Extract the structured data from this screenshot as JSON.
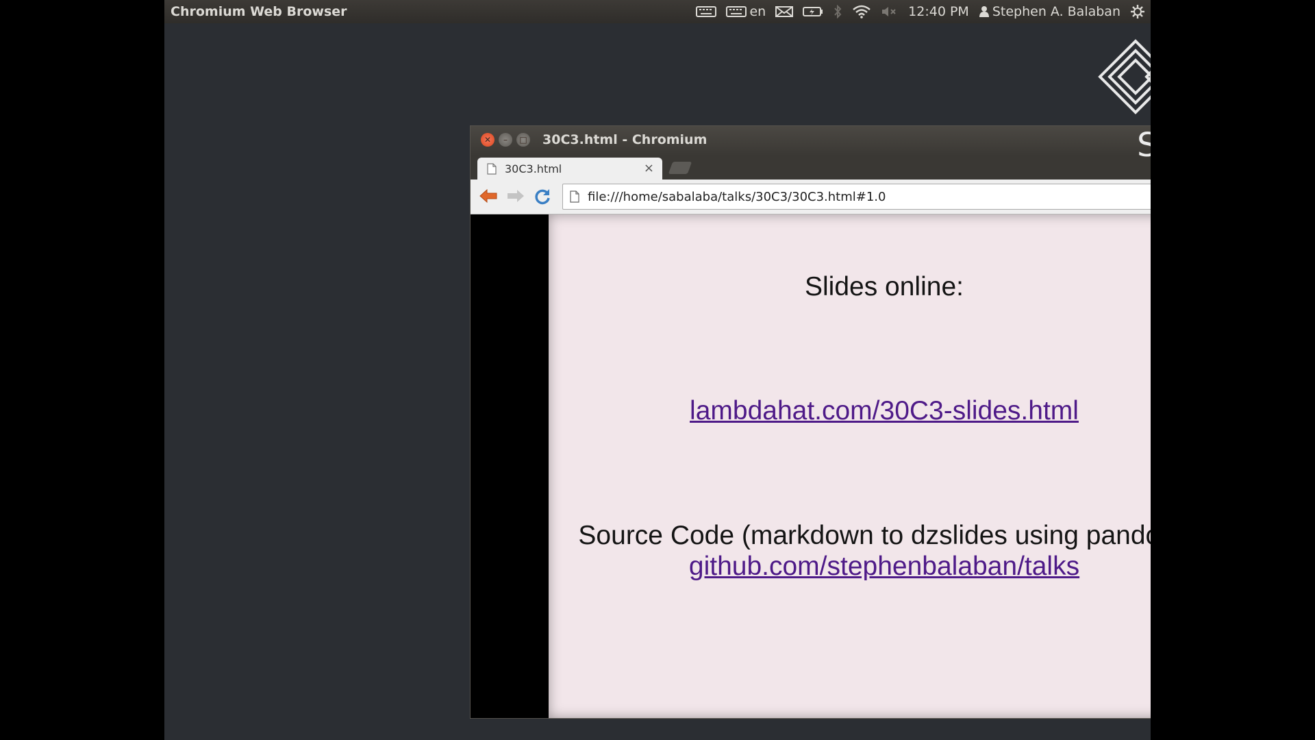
{
  "panel": {
    "app_title": "Chromium Web Browser",
    "keyboard_lang": "en",
    "clock": "12:40 PM",
    "user_name": "Stephen A. Balaban"
  },
  "logo": {
    "room_label": "Saal I"
  },
  "window": {
    "title": "30C3.html - Chromium"
  },
  "tabs": [
    {
      "label": "30C3.html",
      "close": "×"
    }
  ],
  "toolbar": {
    "url": "file:///home/sabalaba/talks/30C3/30C3.html#1.0"
  },
  "slide": {
    "heading": "Slides online:",
    "slides_link": "lambdahat.com/30C3-slides.html",
    "source_label": "Source Code (markdown to dzslides using pandoc):",
    "source_link": "github.com/stephenbalaban/talks"
  },
  "icons": {
    "panel": [
      "keyboard-icon",
      "keyboard-layout-icon",
      "mail-icon",
      "battery-icon",
      "bluetooth-icon",
      "wifi-icon",
      "volume-muted-icon",
      "user-icon",
      "gear-icon"
    ],
    "browser": [
      "back-icon",
      "forward-icon",
      "reload-icon",
      "page-icon",
      "star-icon",
      "dropdown-icon",
      "menu-icon"
    ]
  },
  "colors": {
    "link": "#4e1a88",
    "slide_background": "#f2e6ea",
    "close_button": "#e85a30"
  }
}
